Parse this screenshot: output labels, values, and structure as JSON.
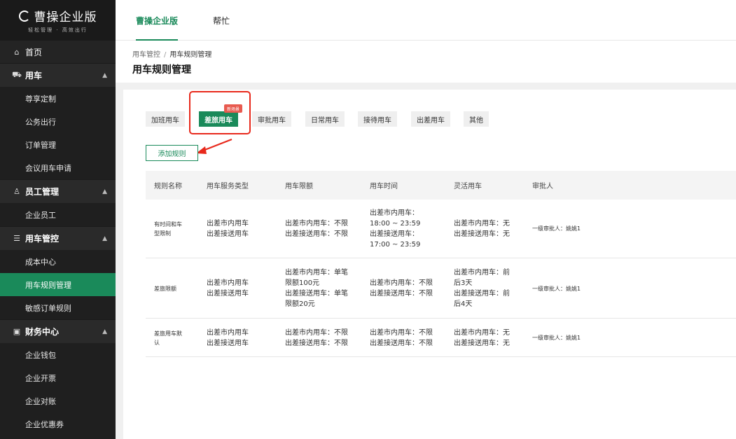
{
  "brand": {
    "name": "曹操企业版",
    "slogan": "轻松管理 · 高效出行"
  },
  "sidebar": {
    "home": {
      "label": "首页",
      "icon": "home-icon"
    },
    "groups": [
      {
        "label": "用车",
        "icon": "car-icon",
        "items": [
          "尊享定制",
          "公务出行",
          "订单管理",
          "会议用车申请"
        ]
      },
      {
        "label": "员工管理",
        "icon": "user-icon",
        "items": [
          "企业员工"
        ]
      },
      {
        "label": "用车管控",
        "icon": "sliders-icon",
        "items": [
          "成本中心",
          "用车规则管理",
          "敏感订单规则"
        ]
      },
      {
        "label": "财务中心",
        "icon": "wallet-icon",
        "items": [
          "企业钱包",
          "企业开票",
          "企业对账",
          "企业优惠券"
        ]
      }
    ],
    "active_item": "用车规则管理"
  },
  "topbar": {
    "tabs": [
      "曹操企业版",
      "帮忙"
    ],
    "active_tab": "曹操企业版"
  },
  "breadcrumb": {
    "parent": "用车管控",
    "separator": "/",
    "current": "用车规则管理"
  },
  "page_title": "用车规则管理",
  "category_tabs": [
    "加班用车",
    "差旅用车",
    "审批用车",
    "日常用车",
    "接待用车",
    "出差用车",
    "其他"
  ],
  "active_category": "差旅用车",
  "new_badge": "新场景",
  "add_button": "添加规则",
  "table": {
    "columns": [
      "规则名称",
      "用车服务类型",
      "用车限额",
      "用车时间",
      "灵活用车",
      "审批人"
    ],
    "rows": [
      {
        "name": [
          "有时间和车",
          "型限制"
        ],
        "service": [
          "出差市内用车",
          "出差接送用车"
        ],
        "limit": [
          "出差市内用车：不限",
          "出差接送用车：不限"
        ],
        "time": [
          "出差市内用车：",
          "18:00 ~ 23:59",
          "出差接送用车：",
          "17:00 ~ 23:59"
        ],
        "flexible": [
          "出差市内用车：无",
          "出差接送用车：无"
        ],
        "approver": "一级审批人：姚姚1"
      },
      {
        "name": [
          "差旅限额"
        ],
        "service": [
          "出差市内用车",
          "出差接送用车"
        ],
        "limit": [
          "出差市内用车：单笔",
          "限额100元",
          "出差接送用车：单笔",
          "限额20元"
        ],
        "time": [
          "出差市内用车：不限",
          "出差接送用车：不限"
        ],
        "flexible": [
          "出差市内用车：前",
          "后3天",
          "出差接送用车：前",
          "后4天"
        ],
        "approver": "一级审批人：姚姚1"
      },
      {
        "name": [
          "差旅用车默",
          "认"
        ],
        "service": [
          "出差市内用车",
          "出差接送用车"
        ],
        "limit": [
          "出差市内用车：不限",
          "出差接送用车：不限"
        ],
        "time": [
          "出差市内用车：不限",
          "出差接送用车：不限"
        ],
        "flexible": [
          "出差市内用车：无",
          "出差接送用车：无"
        ],
        "approver": "一级审批人：姚姚1"
      }
    ]
  },
  "colors": {
    "accent": "#1a8a5a",
    "annotation": "#e8291c",
    "badge": "#e85a4f"
  }
}
